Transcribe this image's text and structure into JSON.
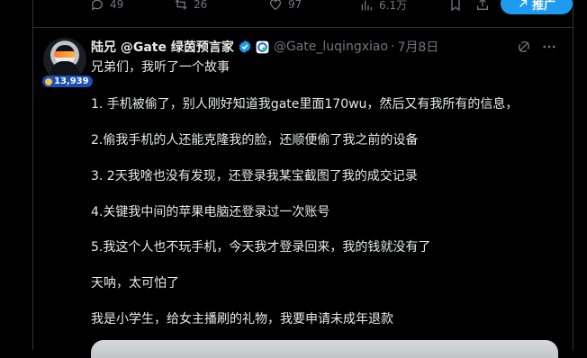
{
  "prev_tweet_actions": {
    "replies": "49",
    "retweets": "26",
    "likes": "97",
    "views": "6.1万",
    "promote_label": "推广"
  },
  "tweet": {
    "author": {
      "display_name": "陆兄 @Gate 绿茵预言家",
      "handle": "@Gate_luqingxiao",
      "followers_badge": "13,939"
    },
    "date": "7月8日",
    "separator": "·",
    "lines": [
      "兄弟们，我听了一个故事",
      "1. 手机被偷了，别人刚好知道我gate里面170wu，然后又有我所有的信息，",
      "2.偷我手机的人还能克隆我的脸，还顺便偷了我之前的设备",
      "3. 2天我啥也没有发现，还登录我某宝截图了我的成交记录",
      "4.关键我中间的苹果电脑还登录过一次账号",
      "5.我这个人也不玩手机，今天我才登录回来，我的钱就没有了",
      "天呐，太可怕了",
      "我是小学生，给女主播刷的礼物，我要申请未成年退款"
    ]
  },
  "colors": {
    "background": "#000000",
    "text": "#e7e9ea",
    "muted": "#71767b",
    "accent": "#1d9bf0",
    "border": "#2f3336"
  }
}
